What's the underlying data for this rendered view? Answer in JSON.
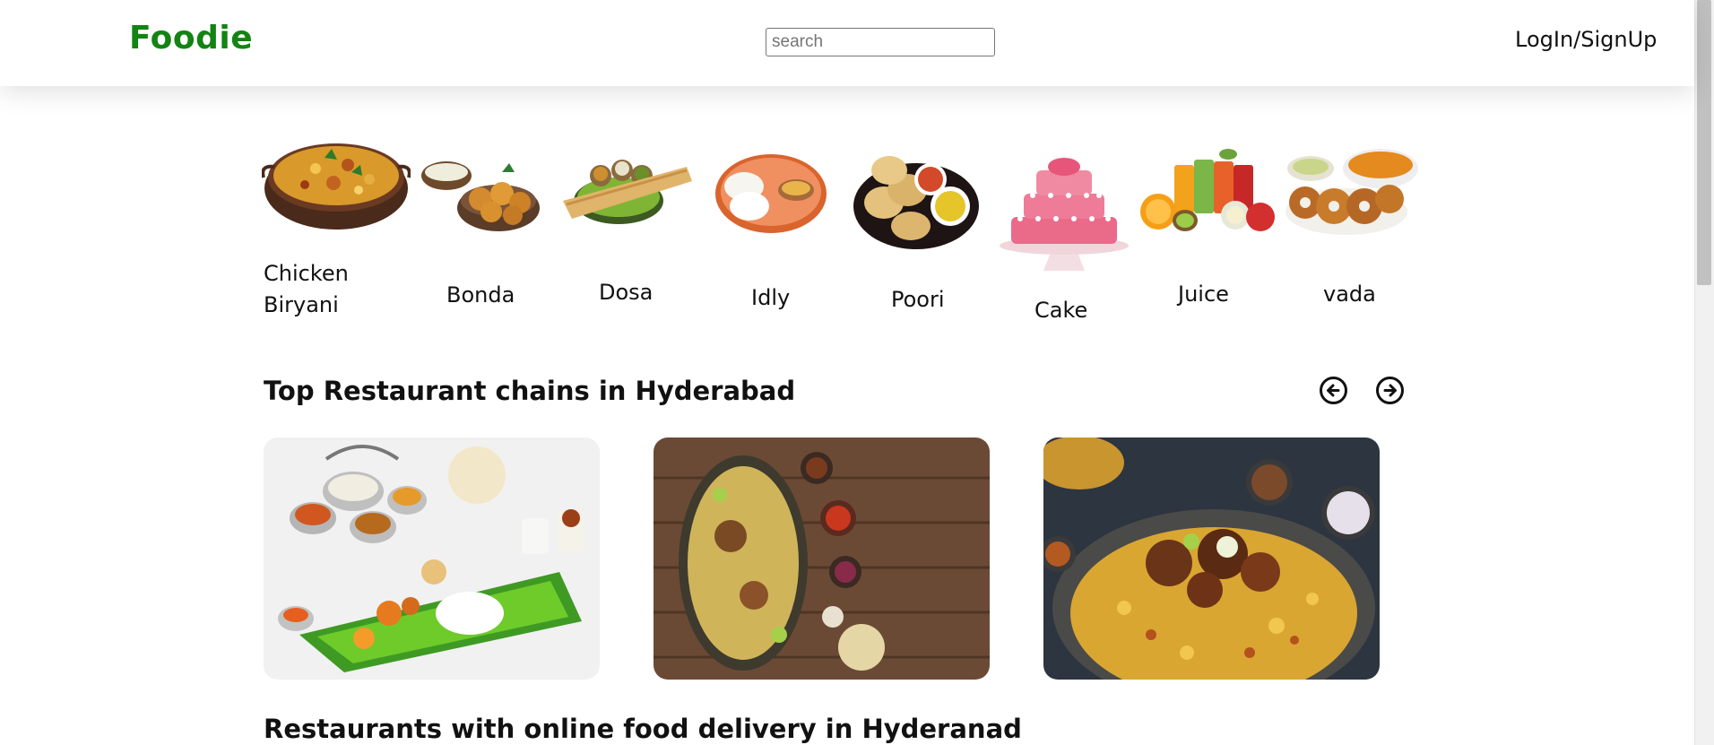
{
  "header": {
    "logo": "Foodie",
    "search_placeholder": "search",
    "login_label": "LogIn/SignUp"
  },
  "categories": [
    {
      "label_line1": "Chicken",
      "label_line2": "Biryani",
      "icon": "biryani-pot"
    },
    {
      "label": "Bonda",
      "icon": "bonda-plate"
    },
    {
      "label": "Dosa",
      "icon": "dosa-plate"
    },
    {
      "label": "Idly",
      "icon": "idly-plate"
    },
    {
      "label": "Poori",
      "icon": "poori-plate"
    },
    {
      "label": "Cake",
      "icon": "tiered-cake"
    },
    {
      "label": "Juice",
      "icon": "juice-glasses"
    },
    {
      "label": "vada",
      "icon": "vada-plate"
    }
  ],
  "top_chains": {
    "title": "Top Restaurant chains in Hyderabad",
    "prev_icon": "arrow-left-circle-icon",
    "next_icon": "arrow-right-circle-icon",
    "cards": [
      {
        "image": "south-indian-thali-on-banana-leaf"
      },
      {
        "image": "biryani-on-wooden-table"
      },
      {
        "image": "chicken-biryani-closeup"
      }
    ]
  },
  "online_delivery": {
    "title": "Restaurants with online food delivery in Hyderanad"
  },
  "colors": {
    "brand": "#138313",
    "text": "#111111",
    "background": "#ffffff"
  }
}
